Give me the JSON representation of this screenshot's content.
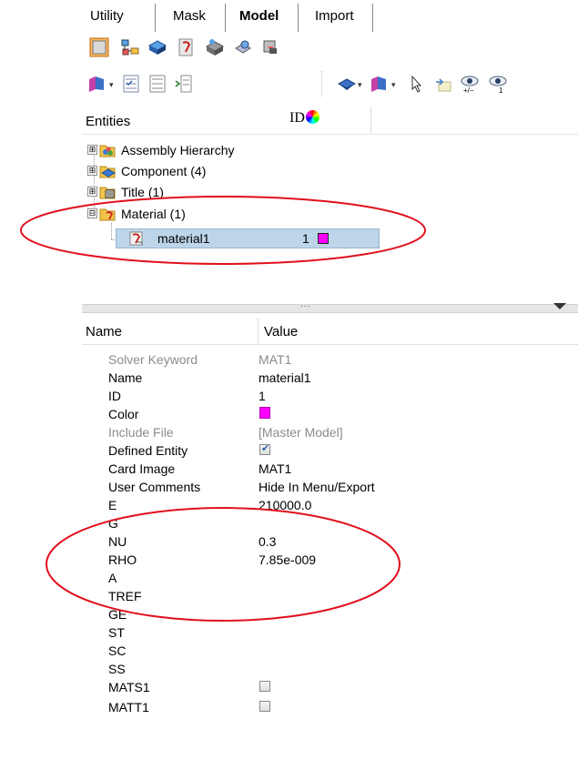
{
  "tabs": [
    {
      "label": "Utility",
      "active": false
    },
    {
      "label": "Mask",
      "active": false
    },
    {
      "label": "Model",
      "active": true
    },
    {
      "label": "Import",
      "active": false
    }
  ],
  "toolbar1": {
    "icons": [
      "entity-square-icon",
      "hierarchy-icon",
      "component-icon",
      "material-icon",
      "property-icon",
      "load-collector-icon",
      "system-icon"
    ]
  },
  "toolbar2": {
    "icons": [
      "view-cube-icon",
      "checked-list-icon",
      "list-icon",
      "expand-list-icon",
      "display-mode-icon",
      "view-orient-icon",
      "cursor-icon",
      "isolate-icon",
      "show-hide-icon",
      "show-only-icon"
    ],
    "show_hide_label": "+/−",
    "show_only_label": "1"
  },
  "entities": {
    "header": "Entities",
    "id_header": "ID",
    "rows": [
      {
        "label": "Assembly Hierarchy",
        "expander": "⊞",
        "icon": "assembly-icon"
      },
      {
        "label": "Component (4)",
        "expander": "⊞",
        "icon": "component-icon"
      },
      {
        "label": "Title (1)",
        "expander": "⊞",
        "icon": "title-icon"
      },
      {
        "label": "Material (1)",
        "expander": "⊟",
        "icon": "material-folder-icon"
      }
    ],
    "selected": {
      "label": "material1",
      "id": "1",
      "color": "#ff00ff"
    }
  },
  "divider": {
    "dots": "..."
  },
  "properties": {
    "header_name": "Name",
    "header_value": "Value",
    "rows": [
      {
        "name": "Solver Keyword",
        "value": "MAT1",
        "disabled": true
      },
      {
        "name": "Name",
        "value": "material1"
      },
      {
        "name": "ID",
        "value": "1"
      },
      {
        "name": "Color",
        "value": "",
        "color": "#ff00ff"
      },
      {
        "name": "Include File",
        "value": "[Master Model]",
        "disabled": true
      },
      {
        "name": "Defined Entity",
        "value": "",
        "checkbox": "checked"
      },
      {
        "name": "Card Image",
        "value": "MAT1"
      },
      {
        "name": "User Comments",
        "value": "Hide In Menu/Export"
      },
      {
        "name": "E",
        "value": "210000.0"
      },
      {
        "name": "G",
        "value": ""
      },
      {
        "name": "NU",
        "value": "0.3"
      },
      {
        "name": "RHO",
        "value": "7.85e-009"
      },
      {
        "name": "A",
        "value": ""
      },
      {
        "name": "TREF",
        "value": ""
      },
      {
        "name": "GE",
        "value": ""
      },
      {
        "name": "ST",
        "value": ""
      },
      {
        "name": "SC",
        "value": ""
      },
      {
        "name": "SS",
        "value": ""
      },
      {
        "name": "MATS1",
        "value": "",
        "checkbox": "unchecked"
      },
      {
        "name": "MATT1",
        "value": "",
        "checkbox": "unchecked"
      }
    ]
  },
  "annotation_color": "#e0101c"
}
